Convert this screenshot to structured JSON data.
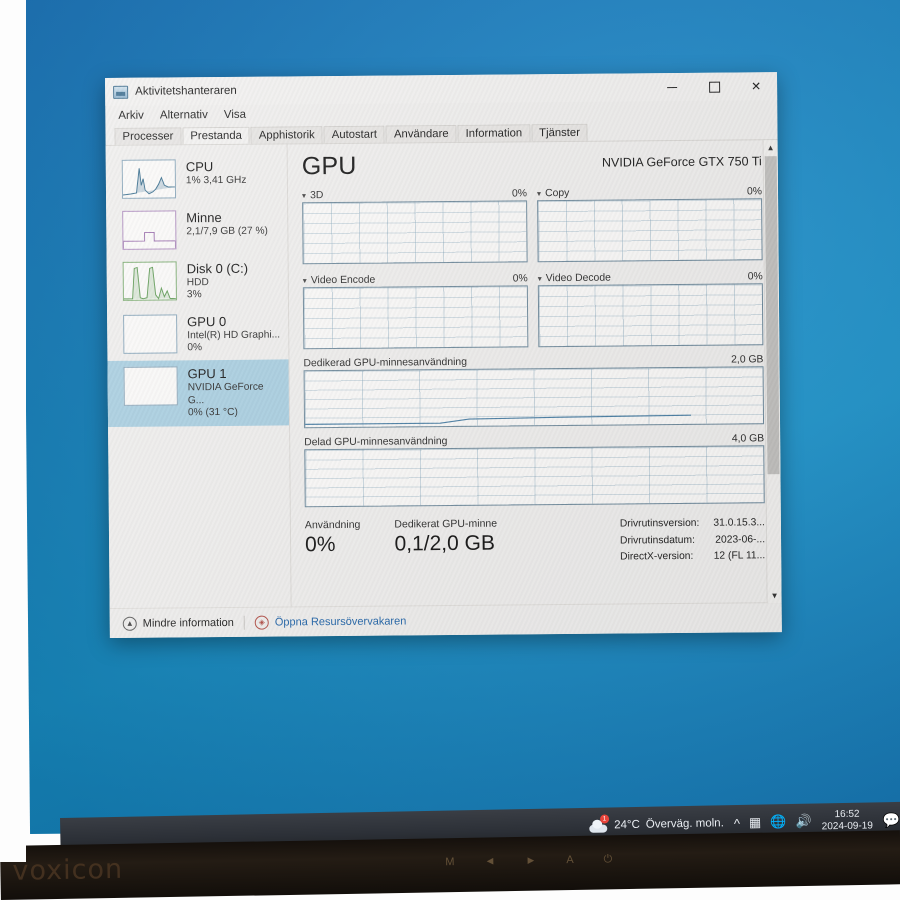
{
  "window": {
    "title": "Aktivitetshanteraren",
    "icon": "task-manager-icon",
    "controls": {
      "minimize": "–",
      "maximize": "□",
      "close": "✕"
    }
  },
  "menubar": {
    "items": [
      "Arkiv",
      "Alternativ",
      "Visa"
    ]
  },
  "tabs": [
    {
      "label": "Processer",
      "active": false
    },
    {
      "label": "Prestanda",
      "active": true
    },
    {
      "label": "Apphistorik",
      "active": false
    },
    {
      "label": "Autostart",
      "active": false
    },
    {
      "label": "Användare",
      "active": false
    },
    {
      "label": "Information",
      "active": false
    },
    {
      "label": "Tjänster",
      "active": false
    }
  ],
  "sidebar": {
    "items": [
      {
        "title": "CPU",
        "sub1": "1% 3,41 GHz",
        "sub2": "",
        "selected": false,
        "accent": "#3a6f8f"
      },
      {
        "title": "Minne",
        "sub1": "2,1/7,9 GB (27 %)",
        "sub2": "",
        "selected": false,
        "accent": "#9b6fae"
      },
      {
        "title": "Disk 0 (C:)",
        "sub1": "HDD",
        "sub2": "3%",
        "selected": false,
        "accent": "#5f9b55"
      },
      {
        "title": "GPU 0",
        "sub1": "Intel(R) HD Graphi...",
        "sub2": "0%",
        "selected": false,
        "accent": "#3a6f8f"
      },
      {
        "title": "GPU 1",
        "sub1": "NVIDIA GeForce G...",
        "sub2": "0% (31 °C)",
        "selected": true,
        "accent": "#3a6f8f"
      }
    ]
  },
  "main": {
    "heading": "GPU",
    "model": "NVIDIA GeForce GTX 750 Ti",
    "graphs": [
      {
        "name": "3D",
        "value": "0%"
      },
      {
        "name": "Copy",
        "value": "0%"
      },
      {
        "name": "Video Encode",
        "value": "0%"
      },
      {
        "name": "Video Decode",
        "value": "0%"
      }
    ],
    "memory": [
      {
        "name": "Dedikerad GPU-minnesanvändning",
        "max": "2,0 GB"
      },
      {
        "name": "Delad GPU-minnesanvändning",
        "max": "4,0 GB"
      }
    ],
    "stats": [
      {
        "label": "Användning",
        "value": "0%"
      },
      {
        "label": "Dedikerat GPU-minne",
        "value": "0,1/2,0 GB"
      }
    ],
    "driver": {
      "keys": [
        "Drivrutinsversion:",
        "Drivrutinsdatum:",
        "DirectX-version:"
      ],
      "values": [
        "31.0.15.3...",
        "2023-06-...",
        "12 (FL 11..."
      ]
    }
  },
  "footer": {
    "less_info": "Mindre information",
    "resource_monitor": "Öppna Resursövervakaren",
    "less_icon": "chevron-up-circle-icon",
    "resource_icon": "resource-monitor-icon"
  },
  "taskbar": {
    "temperature": "24°C",
    "weather": "Överväg. moln.",
    "badge": "1",
    "time": "16:52",
    "date": "2024-09-19",
    "icons": [
      "chevron-up-icon",
      "meet-now-icon",
      "network-icon",
      "volume-icon",
      "chat-icon"
    ]
  },
  "monitor": {
    "brand": "voxicon",
    "buttons": [
      "M",
      "◄",
      "►",
      "A",
      "⏻"
    ]
  },
  "colors": {
    "desktop_blue": "#1787c4",
    "selected_row": "#a9cfe1",
    "link_blue": "#1f63a8",
    "window_bg": "#f0efee"
  }
}
